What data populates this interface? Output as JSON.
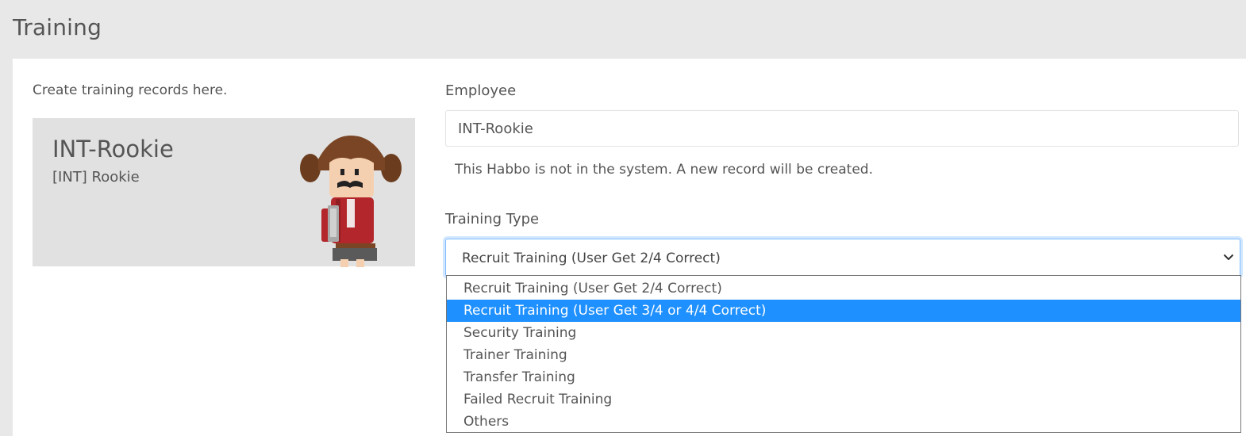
{
  "page": {
    "title": "Training"
  },
  "intro": {
    "text": "Create training records here."
  },
  "profile": {
    "name": "INT-Rookie",
    "rank": "[INT] Rookie"
  },
  "form": {
    "employee": {
      "label": "Employee",
      "value": "INT-Rookie",
      "help": "This Habbo is not in the system. A new record will be created."
    },
    "training_type": {
      "label": "Training Type",
      "selected": "Recruit Training (User Get 2/4 Correct)",
      "highlighted_index": 1,
      "options": [
        "Recruit Training (User Get 2/4 Correct)",
        "Recruit Training (User Get 3/4 or 4/4 Correct)",
        "Security Training",
        "Trainer Training",
        "Transfer Training",
        "Failed Recruit Training",
        "Others"
      ]
    }
  },
  "colors": {
    "page_bg": "#e8e8e8",
    "panel_bg": "#ffffff",
    "card_bg": "#e1e1e1",
    "text": "#555555",
    "focus_border": "#80bdff",
    "highlight": "#1e90ff"
  },
  "icons": {
    "select_arrow": "chevron-down-icon",
    "avatar": "habbo-avatar"
  }
}
